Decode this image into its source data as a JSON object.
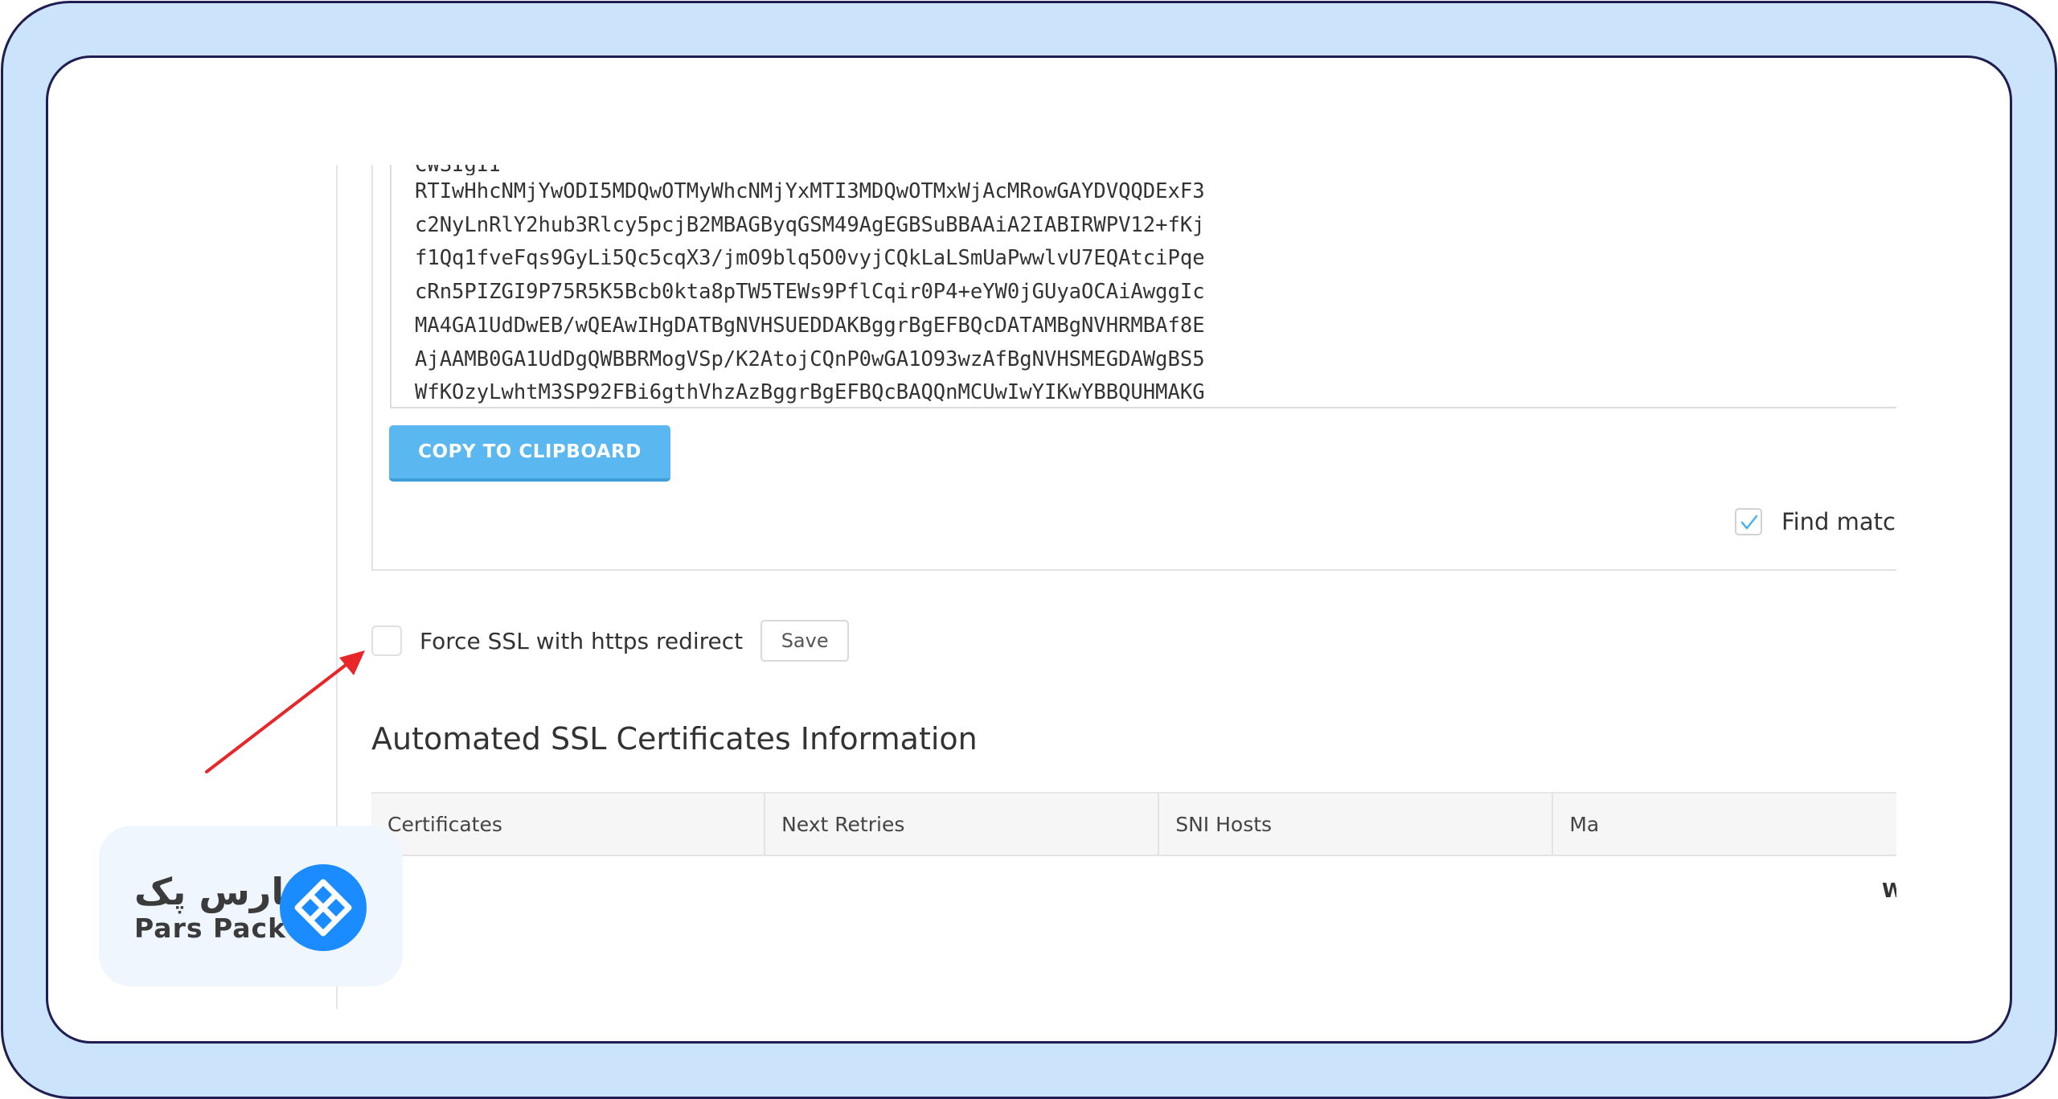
{
  "certificate": {
    "partial_top_line": "CWSIgII",
    "lines": [
      "RTIwHhcNMjYwODI5MDQwOTMyWhcNMjYxMTI3MDQwOTMxWjAcMRowGAYDVQQDExF3",
      "c2NyLnRlY2hub3Rlcy5pcjB2MBAGByqGSM49AgEGBSuBBAAiA2IABIRWPV12+fKj",
      "f1Qq1fveFqs9GyLi5Qc5cqX3/jmO9blq5O0vyjCQkLaLSmUaPwwlvU7EQAtciPqe",
      "cRn5PIZGI9P75R5K5Bcb0kta8pTW5TEWs9PflCqir0P4+eYW0jGUyaOCAiAwggIc",
      "MA4GA1UdDwEB/wQEAwIHgDATBgNVHSUEDDAKBggrBgEFBQcDATAMBgNVHRMBAf8E",
      "AjAAMB0GA1UdDgQWBBRMogVSp/K2AtojCQnP0wGA1O93wzAfBgNVHSMEGDAWgBS5",
      "WfKOzyLwhtM3SP92FBi6gthVhzAzBggrBgEFBQcBAQQnMCUwIwYIKwYBBQUHMAKG"
    ],
    "copy_button": "COPY TO CLIPBOARD"
  },
  "find_match": {
    "label": "Find matc",
    "checked": true
  },
  "force_ssl": {
    "label": "Force SSL with https redirect",
    "checked": false,
    "save_button": "Save"
  },
  "auto_ssl": {
    "title": "Automated SSL Certificates Information",
    "columns": [
      "Certificates",
      "Next Retries",
      "SNI Hosts",
      "Ma"
    ],
    "row_partial_cell": "W"
  },
  "logo": {
    "persian_text": "پارس پک",
    "english_text": "Pars Pack",
    "brand_color": "#1a8cff"
  },
  "annotation": {
    "arrow_color": "#e8262a"
  }
}
